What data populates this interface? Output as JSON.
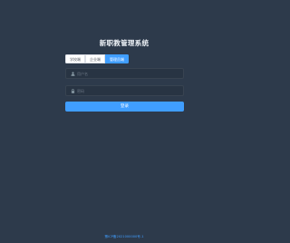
{
  "app": {
    "title": "新职教管理系统"
  },
  "role_tabs": [
    {
      "label": "学校端",
      "active": false
    },
    {
      "label": "企业端",
      "active": false
    },
    {
      "label": "管理员端",
      "active": true
    }
  ],
  "form": {
    "username": {
      "placeholder": "用户名",
      "value": "",
      "icon": "user-icon"
    },
    "password": {
      "placeholder": "密码",
      "value": "",
      "icon": "lock-icon"
    },
    "login_label": "登录"
  },
  "footer": {
    "text": "豫ICP备2021000000号-1"
  },
  "colors": {
    "background": "#2d3a4b",
    "accent": "#409eff",
    "input_bg": "#283443"
  }
}
